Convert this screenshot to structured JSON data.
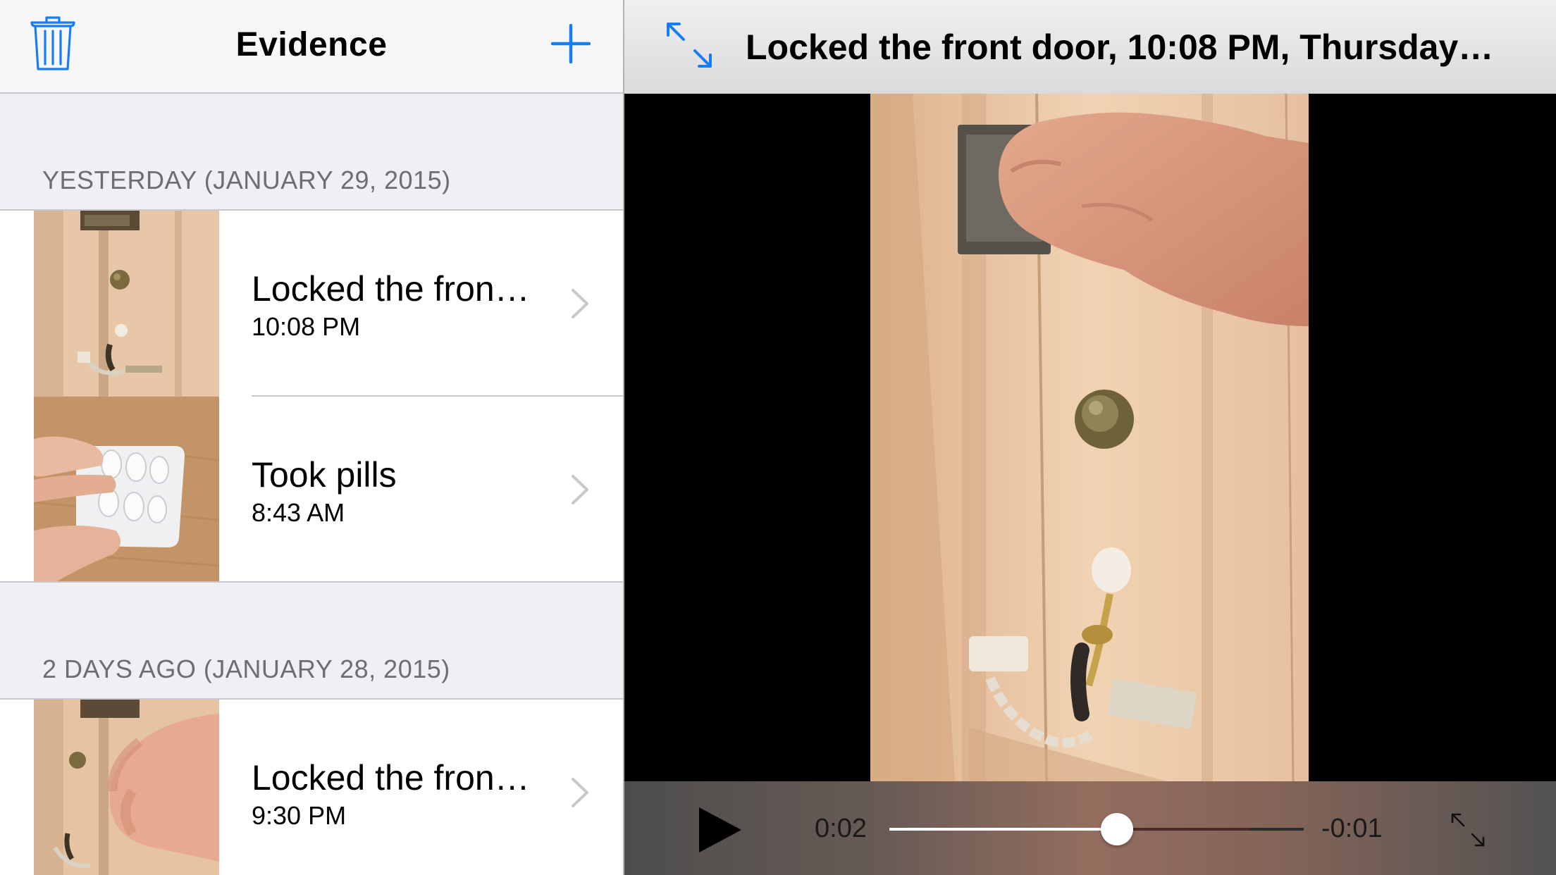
{
  "master": {
    "title": "Evidence",
    "sections": [
      {
        "header": "YESTERDAY (JANUARY 29, 2015)",
        "items": [
          {
            "title": "Locked the fron…",
            "subtitle": "10:08 PM",
            "thumbnail": "door-lock-thumbnail"
          },
          {
            "title": "Took pills",
            "subtitle": "8:43 AM",
            "thumbnail": "pills-thumbnail"
          }
        ]
      },
      {
        "header": "2 DAYS AGO (JANUARY 28, 2015)",
        "items": [
          {
            "title": "Locked the fron…",
            "subtitle": "9:30 PM",
            "thumbnail": "door-lock-thumbnail"
          }
        ]
      }
    ]
  },
  "detail": {
    "title": "Locked the front door, 10:08 PM, Thursday…",
    "player": {
      "elapsed": "0:02",
      "remaining": "-0:01",
      "progress": 0.55,
      "buffered": 0.87
    }
  },
  "colors": {
    "tint": "#1a7cf5",
    "secondary_text": "#6d6d72",
    "chevron": "#c7c7cc",
    "grouped_background": "#efeff4"
  },
  "icons": {
    "delete": "trash-icon",
    "add": "plus-icon",
    "expand": "expand-arrows-icon",
    "play": "play-icon",
    "fullscreen": "fullscreen-icon",
    "disclosure": "chevron-right-icon"
  }
}
